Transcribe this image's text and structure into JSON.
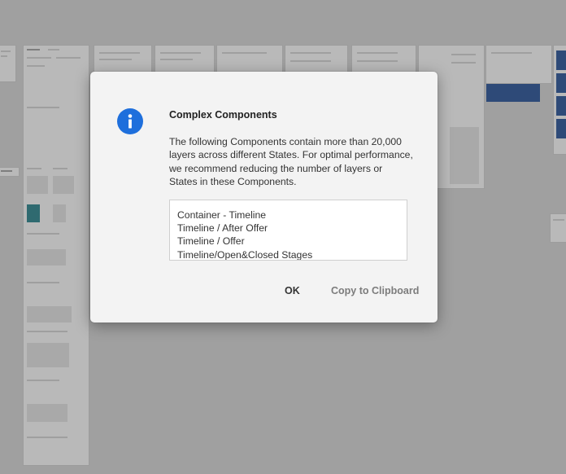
{
  "dialog": {
    "icon": "info-icon",
    "title": "Complex Components",
    "message": "The following Components contain more than 20,000 layers across different States. For optimal performance, we recommend reducing the number of layers or States in these Components.",
    "components": [
      "Container - Timeline",
      "Timeline / After Offer",
      "Timeline / Offer",
      "Timeline/Open&Closed Stages"
    ],
    "ok_label": "OK",
    "copy_label": "Copy to Clipboard",
    "accent_color": "#1e6fdc"
  }
}
